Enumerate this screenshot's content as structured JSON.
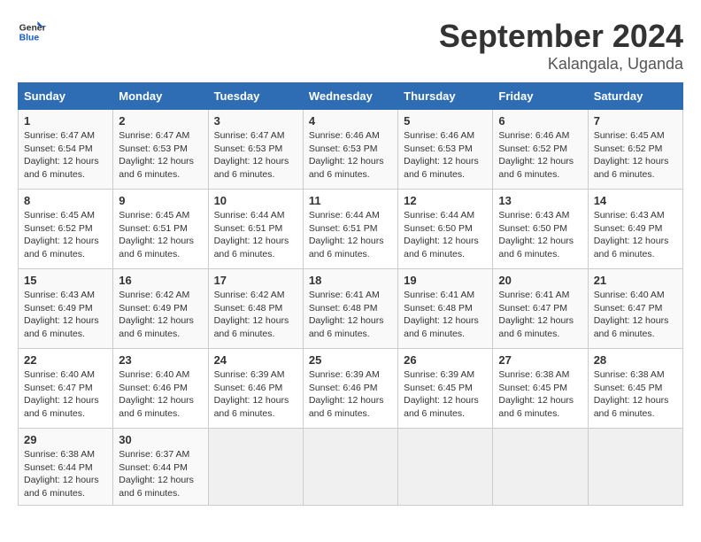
{
  "header": {
    "logo_line1": "General",
    "logo_line2": "Blue",
    "month": "September 2024",
    "location": "Kalangala, Uganda"
  },
  "weekdays": [
    "Sunday",
    "Monday",
    "Tuesday",
    "Wednesday",
    "Thursday",
    "Friday",
    "Saturday"
  ],
  "weeks": [
    [
      {
        "day": "1",
        "info": "Sunrise: 6:47 AM\nSunset: 6:54 PM\nDaylight: 12 hours\nand 6 minutes."
      },
      {
        "day": "2",
        "info": "Sunrise: 6:47 AM\nSunset: 6:53 PM\nDaylight: 12 hours\nand 6 minutes."
      },
      {
        "day": "3",
        "info": "Sunrise: 6:47 AM\nSunset: 6:53 PM\nDaylight: 12 hours\nand 6 minutes."
      },
      {
        "day": "4",
        "info": "Sunrise: 6:46 AM\nSunset: 6:53 PM\nDaylight: 12 hours\nand 6 minutes."
      },
      {
        "day": "5",
        "info": "Sunrise: 6:46 AM\nSunset: 6:53 PM\nDaylight: 12 hours\nand 6 minutes."
      },
      {
        "day": "6",
        "info": "Sunrise: 6:46 AM\nSunset: 6:52 PM\nDaylight: 12 hours\nand 6 minutes."
      },
      {
        "day": "7",
        "info": "Sunrise: 6:45 AM\nSunset: 6:52 PM\nDaylight: 12 hours\nand 6 minutes."
      }
    ],
    [
      {
        "day": "8",
        "info": "Sunrise: 6:45 AM\nSunset: 6:52 PM\nDaylight: 12 hours\nand 6 minutes."
      },
      {
        "day": "9",
        "info": "Sunrise: 6:45 AM\nSunset: 6:51 PM\nDaylight: 12 hours\nand 6 minutes."
      },
      {
        "day": "10",
        "info": "Sunrise: 6:44 AM\nSunset: 6:51 PM\nDaylight: 12 hours\nand 6 minutes."
      },
      {
        "day": "11",
        "info": "Sunrise: 6:44 AM\nSunset: 6:51 PM\nDaylight: 12 hours\nand 6 minutes."
      },
      {
        "day": "12",
        "info": "Sunrise: 6:44 AM\nSunset: 6:50 PM\nDaylight: 12 hours\nand 6 minutes."
      },
      {
        "day": "13",
        "info": "Sunrise: 6:43 AM\nSunset: 6:50 PM\nDaylight: 12 hours\nand 6 minutes."
      },
      {
        "day": "14",
        "info": "Sunrise: 6:43 AM\nSunset: 6:49 PM\nDaylight: 12 hours\nand 6 minutes."
      }
    ],
    [
      {
        "day": "15",
        "info": "Sunrise: 6:43 AM\nSunset: 6:49 PM\nDaylight: 12 hours\nand 6 minutes."
      },
      {
        "day": "16",
        "info": "Sunrise: 6:42 AM\nSunset: 6:49 PM\nDaylight: 12 hours\nand 6 minutes."
      },
      {
        "day": "17",
        "info": "Sunrise: 6:42 AM\nSunset: 6:48 PM\nDaylight: 12 hours\nand 6 minutes."
      },
      {
        "day": "18",
        "info": "Sunrise: 6:41 AM\nSunset: 6:48 PM\nDaylight: 12 hours\nand 6 minutes."
      },
      {
        "day": "19",
        "info": "Sunrise: 6:41 AM\nSunset: 6:48 PM\nDaylight: 12 hours\nand 6 minutes."
      },
      {
        "day": "20",
        "info": "Sunrise: 6:41 AM\nSunset: 6:47 PM\nDaylight: 12 hours\nand 6 minutes."
      },
      {
        "day": "21",
        "info": "Sunrise: 6:40 AM\nSunset: 6:47 PM\nDaylight: 12 hours\nand 6 minutes."
      }
    ],
    [
      {
        "day": "22",
        "info": "Sunrise: 6:40 AM\nSunset: 6:47 PM\nDaylight: 12 hours\nand 6 minutes."
      },
      {
        "day": "23",
        "info": "Sunrise: 6:40 AM\nSunset: 6:46 PM\nDaylight: 12 hours\nand 6 minutes."
      },
      {
        "day": "24",
        "info": "Sunrise: 6:39 AM\nSunset: 6:46 PM\nDaylight: 12 hours\nand 6 minutes."
      },
      {
        "day": "25",
        "info": "Sunrise: 6:39 AM\nSunset: 6:46 PM\nDaylight: 12 hours\nand 6 minutes."
      },
      {
        "day": "26",
        "info": "Sunrise: 6:39 AM\nSunset: 6:45 PM\nDaylight: 12 hours\nand 6 minutes."
      },
      {
        "day": "27",
        "info": "Sunrise: 6:38 AM\nSunset: 6:45 PM\nDaylight: 12 hours\nand 6 minutes."
      },
      {
        "day": "28",
        "info": "Sunrise: 6:38 AM\nSunset: 6:45 PM\nDaylight: 12 hours\nand 6 minutes."
      }
    ],
    [
      {
        "day": "29",
        "info": "Sunrise: 6:38 AM\nSunset: 6:44 PM\nDaylight: 12 hours\nand 6 minutes."
      },
      {
        "day": "30",
        "info": "Sunrise: 6:37 AM\nSunset: 6:44 PM\nDaylight: 12 hours\nand 6 minutes."
      },
      {
        "day": "",
        "info": ""
      },
      {
        "day": "",
        "info": ""
      },
      {
        "day": "",
        "info": ""
      },
      {
        "day": "",
        "info": ""
      },
      {
        "day": "",
        "info": ""
      }
    ]
  ]
}
